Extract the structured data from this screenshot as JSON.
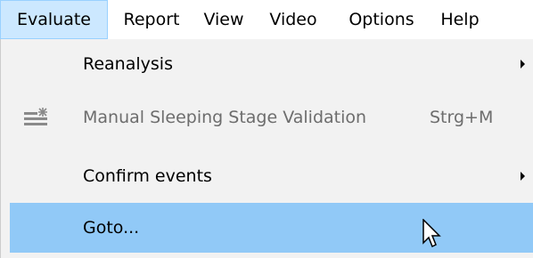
{
  "menubar": {
    "items": [
      {
        "label": "Evaluate"
      },
      {
        "label": "Report"
      },
      {
        "label": "View"
      },
      {
        "label": "Video"
      },
      {
        "label": "Options"
      },
      {
        "label": "Help"
      }
    ]
  },
  "dropdown": {
    "items": [
      {
        "label": "Reanalysis",
        "has_submenu": true,
        "disabled": false
      },
      {
        "label": "Manual Sleeping Stage Validation",
        "shortcut": "Strg+M",
        "disabled": true,
        "icon": "validation-icon"
      },
      {
        "label": "Confirm events",
        "has_submenu": true,
        "disabled": false
      },
      {
        "label": "Goto...",
        "highlighted": true,
        "disabled": false
      }
    ]
  },
  "colors": {
    "menubar_active_bg": "#cce8ff",
    "menubar_active_border": "#99d1ff",
    "dropdown_bg": "#f2f2f2",
    "highlight_bg": "#91c9f7",
    "disabled_text": "#6d6d6d"
  }
}
